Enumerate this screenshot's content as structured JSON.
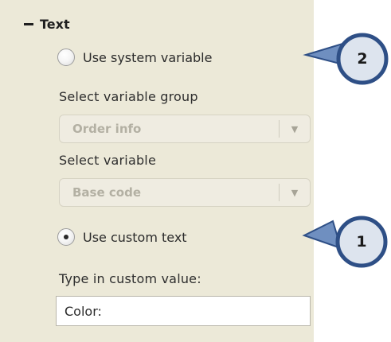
{
  "section": {
    "title": "Text"
  },
  "options": {
    "system_variable_label": "Use system variable",
    "custom_text_label": "Use custom text"
  },
  "variable_group": {
    "label": "Select variable group",
    "value": "Order info"
  },
  "variable": {
    "label": "Select variable",
    "value": "Base code"
  },
  "custom_value": {
    "label": "Type in custom value:",
    "value": "Color:"
  },
  "callouts": {
    "top": "2",
    "bottom": "1"
  },
  "colors": {
    "panel_bg": "#ece9d8",
    "callout_fill": "#dde4ee",
    "callout_border": "#2e4f86",
    "arrow_fill": "#6f8fc0"
  },
  "icons": {
    "collapse": "minus-icon",
    "dropdown": "triangle-down-icon"
  }
}
